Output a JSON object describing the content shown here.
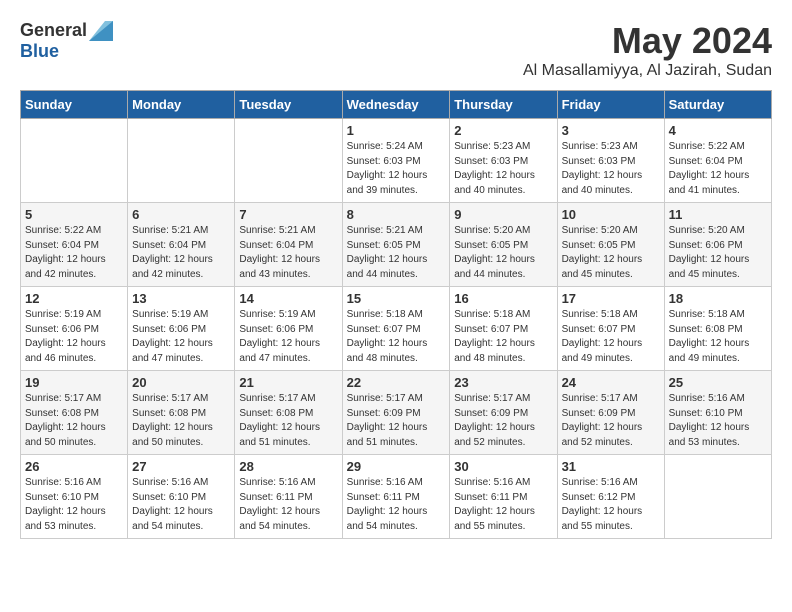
{
  "logo": {
    "general": "General",
    "blue": "Blue"
  },
  "title": {
    "month": "May 2024",
    "location": "Al Masallamiyya, Al Jazirah, Sudan"
  },
  "days_header": [
    "Sunday",
    "Monday",
    "Tuesday",
    "Wednesday",
    "Thursday",
    "Friday",
    "Saturday"
  ],
  "weeks": [
    [
      {
        "day": "",
        "info": ""
      },
      {
        "day": "",
        "info": ""
      },
      {
        "day": "",
        "info": ""
      },
      {
        "day": "1",
        "info": "Sunrise: 5:24 AM\nSunset: 6:03 PM\nDaylight: 12 hours\nand 39 minutes."
      },
      {
        "day": "2",
        "info": "Sunrise: 5:23 AM\nSunset: 6:03 PM\nDaylight: 12 hours\nand 40 minutes."
      },
      {
        "day": "3",
        "info": "Sunrise: 5:23 AM\nSunset: 6:03 PM\nDaylight: 12 hours\nand 40 minutes."
      },
      {
        "day": "4",
        "info": "Sunrise: 5:22 AM\nSunset: 6:04 PM\nDaylight: 12 hours\nand 41 minutes."
      }
    ],
    [
      {
        "day": "5",
        "info": "Sunrise: 5:22 AM\nSunset: 6:04 PM\nDaylight: 12 hours\nand 42 minutes."
      },
      {
        "day": "6",
        "info": "Sunrise: 5:21 AM\nSunset: 6:04 PM\nDaylight: 12 hours\nand 42 minutes."
      },
      {
        "day": "7",
        "info": "Sunrise: 5:21 AM\nSunset: 6:04 PM\nDaylight: 12 hours\nand 43 minutes."
      },
      {
        "day": "8",
        "info": "Sunrise: 5:21 AM\nSunset: 6:05 PM\nDaylight: 12 hours\nand 44 minutes."
      },
      {
        "day": "9",
        "info": "Sunrise: 5:20 AM\nSunset: 6:05 PM\nDaylight: 12 hours\nand 44 minutes."
      },
      {
        "day": "10",
        "info": "Sunrise: 5:20 AM\nSunset: 6:05 PM\nDaylight: 12 hours\nand 45 minutes."
      },
      {
        "day": "11",
        "info": "Sunrise: 5:20 AM\nSunset: 6:06 PM\nDaylight: 12 hours\nand 45 minutes."
      }
    ],
    [
      {
        "day": "12",
        "info": "Sunrise: 5:19 AM\nSunset: 6:06 PM\nDaylight: 12 hours\nand 46 minutes."
      },
      {
        "day": "13",
        "info": "Sunrise: 5:19 AM\nSunset: 6:06 PM\nDaylight: 12 hours\nand 47 minutes."
      },
      {
        "day": "14",
        "info": "Sunrise: 5:19 AM\nSunset: 6:06 PM\nDaylight: 12 hours\nand 47 minutes."
      },
      {
        "day": "15",
        "info": "Sunrise: 5:18 AM\nSunset: 6:07 PM\nDaylight: 12 hours\nand 48 minutes."
      },
      {
        "day": "16",
        "info": "Sunrise: 5:18 AM\nSunset: 6:07 PM\nDaylight: 12 hours\nand 48 minutes."
      },
      {
        "day": "17",
        "info": "Sunrise: 5:18 AM\nSunset: 6:07 PM\nDaylight: 12 hours\nand 49 minutes."
      },
      {
        "day": "18",
        "info": "Sunrise: 5:18 AM\nSunset: 6:08 PM\nDaylight: 12 hours\nand 49 minutes."
      }
    ],
    [
      {
        "day": "19",
        "info": "Sunrise: 5:17 AM\nSunset: 6:08 PM\nDaylight: 12 hours\nand 50 minutes."
      },
      {
        "day": "20",
        "info": "Sunrise: 5:17 AM\nSunset: 6:08 PM\nDaylight: 12 hours\nand 50 minutes."
      },
      {
        "day": "21",
        "info": "Sunrise: 5:17 AM\nSunset: 6:08 PM\nDaylight: 12 hours\nand 51 minutes."
      },
      {
        "day": "22",
        "info": "Sunrise: 5:17 AM\nSunset: 6:09 PM\nDaylight: 12 hours\nand 51 minutes."
      },
      {
        "day": "23",
        "info": "Sunrise: 5:17 AM\nSunset: 6:09 PM\nDaylight: 12 hours\nand 52 minutes."
      },
      {
        "day": "24",
        "info": "Sunrise: 5:17 AM\nSunset: 6:09 PM\nDaylight: 12 hours\nand 52 minutes."
      },
      {
        "day": "25",
        "info": "Sunrise: 5:16 AM\nSunset: 6:10 PM\nDaylight: 12 hours\nand 53 minutes."
      }
    ],
    [
      {
        "day": "26",
        "info": "Sunrise: 5:16 AM\nSunset: 6:10 PM\nDaylight: 12 hours\nand 53 minutes."
      },
      {
        "day": "27",
        "info": "Sunrise: 5:16 AM\nSunset: 6:10 PM\nDaylight: 12 hours\nand 54 minutes."
      },
      {
        "day": "28",
        "info": "Sunrise: 5:16 AM\nSunset: 6:11 PM\nDaylight: 12 hours\nand 54 minutes."
      },
      {
        "day": "29",
        "info": "Sunrise: 5:16 AM\nSunset: 6:11 PM\nDaylight: 12 hours\nand 54 minutes."
      },
      {
        "day": "30",
        "info": "Sunrise: 5:16 AM\nSunset: 6:11 PM\nDaylight: 12 hours\nand 55 minutes."
      },
      {
        "day": "31",
        "info": "Sunrise: 5:16 AM\nSunset: 6:12 PM\nDaylight: 12 hours\nand 55 minutes."
      },
      {
        "day": "",
        "info": ""
      }
    ]
  ]
}
